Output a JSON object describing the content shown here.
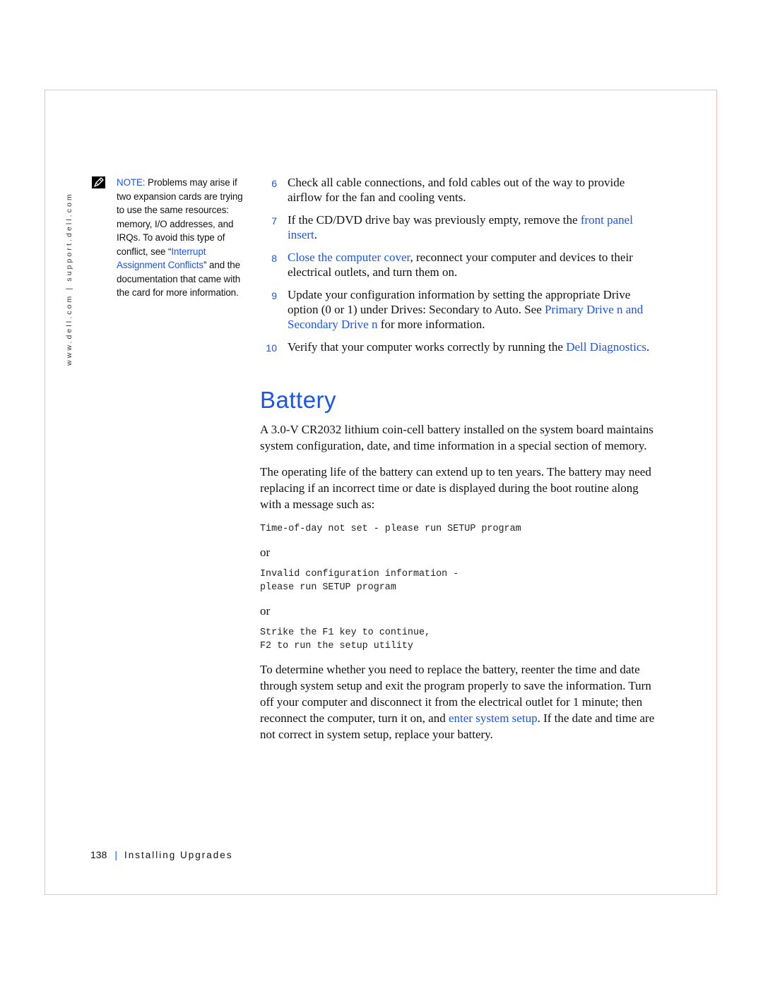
{
  "side_url": "www.dell.com  |  support.dell.com",
  "note": {
    "icon": "pencil-note-icon",
    "label": "NOTE:",
    "text_before": " Problems may arise if two expansion cards are trying to use the same resources: memory, I/O addresses, and IRQs. To avoid this type of conflict, see “",
    "link": "Interrupt Assignment Conflicts",
    "text_after": "” and the documentation that came with the card for more information."
  },
  "steps": [
    {
      "num": "6",
      "parts": [
        {
          "text": "Check all cable connections, and fold cables out of the way to provide airflow for the fan and cooling vents."
        }
      ]
    },
    {
      "num": "7",
      "parts": [
        {
          "text": "If the CD/DVD drive bay was previously empty, remove the "
        },
        {
          "text": "front panel insert",
          "link": true
        },
        {
          "text": "."
        }
      ]
    },
    {
      "num": "8",
      "parts": [
        {
          "text": "Close the computer cover",
          "link": true
        },
        {
          "text": ", reconnect your computer and devices to their electrical outlets, and turn them on."
        }
      ]
    },
    {
      "num": "9",
      "parts": [
        {
          "text": "Update your configuration information by setting the appropriate Drive option (0 or 1) under Drives: Secondary to Auto. See "
        },
        {
          "text": "Primary Drive n and Secondary Drive n",
          "link": true
        },
        {
          "text": " for more information."
        }
      ]
    },
    {
      "num": "10",
      "parts": [
        {
          "text": "Verify that your computer works correctly by running the "
        },
        {
          "text": "Dell Diagnostics",
          "link": true
        },
        {
          "text": "."
        }
      ]
    }
  ],
  "section": {
    "title": "Battery",
    "para1": "A 3.0-V CR2032 lithium coin-cell battery installed on the system board maintains system configuration, date, and time information in a special section of memory.",
    "para2": "The operating life of the battery can extend up to ten years. The battery may need replacing if an incorrect time or date is displayed during the boot routine along with a message such as:",
    "code1": "Time-of-day not set - please run SETUP program",
    "or1": "or",
    "code2": "Invalid configuration information -\nplease run SETUP program",
    "or2": "or",
    "code3": "Strike the F1 key to continue,\nF2 to run the setup utility",
    "para3_before": "To determine whether you need to replace the battery, reenter the time and date through system setup and exit the program properly to save the information. Turn off your computer and disconnect it from the electrical outlet for 1 minute; then reconnect the computer, turn it on, and ",
    "para3_link": "enter system setup",
    "para3_after": ". If the date and time are not correct in system setup, replace your battery."
  },
  "footer": {
    "page_number": "138",
    "separator": "|",
    "chapter": "Installing Upgrades"
  },
  "colors": {
    "link": "#1a54e8",
    "frame": "#f3bcb6",
    "text": "#111111"
  }
}
